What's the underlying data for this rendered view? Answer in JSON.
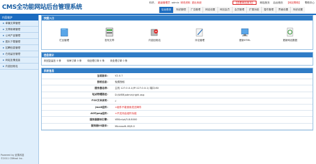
{
  "header": {
    "logo_text": "CMS全功能网站后台管理系统",
    "greeting_prefix": "你好，",
    "role": "超级管理员",
    "user": "admin",
    "settings_link": "修改资料",
    "logout_link": "退出系统",
    "view_site": "【查看网站首页】",
    "top_links": [
      "网站首页",
      "后台首页"
    ],
    "site_help": "【网站帮助】",
    "help_center": "帮助中心"
  },
  "nav": [
    "后台首页",
    "系统管理",
    "广告管理",
    "网站设置",
    "网站会员",
    "会员管理",
    "扩展功能",
    "插件管理",
    "界面设置",
    "系统设置"
  ],
  "sidebar": {
    "title": "内容维护",
    "items": [
      "单篇文章管理",
      "文章新闻管理",
      "公司产品管理",
      "图片下载管理",
      "招聘信息管理",
      "在线留言管理",
      "网站友情连接",
      "内容回收站"
    ]
  },
  "footer": {
    "line1": "Powered by 武夷科技",
    "line2": "©2011 CBHost Inc."
  },
  "quick": {
    "title": "快捷入口",
    "items": [
      {
        "label": "栏目管理",
        "icon": "folder-icon"
      },
      {
        "label": "发布文章",
        "icon": "server-icon"
      },
      {
        "label": "内容回收站",
        "icon": "recycle-icon"
      },
      {
        "label": "评论管理",
        "icon": "comment-icon"
      },
      {
        "label": "更新HTML",
        "icon": "update-icon"
      },
      {
        "label": "更新网站数据",
        "icon": "refresh-data-icon"
      }
    ]
  },
  "stats": {
    "title": "信息统计",
    "items": [
      "未回复留言 0 条",
      "待审订单 0 条",
      "待处理订单 0 条",
      "未处理订单 0 条"
    ]
  },
  "sysinfo": {
    "title": "系统信息",
    "rows": [
      {
        "key": "当前版本：",
        "value": "V2.0.7",
        "red": false
      },
      {
        "key": "授权信息：",
        "value": "免费授权",
        "red": false
      },
      {
        "key": "服务器名称：",
        "value": "主机 127.0.0.1(IP:127.0.0.1) 端口:80",
        "red": false
      },
      {
        "key": "站点物理路径：",
        "value": "D:\\WEB\\admin\\right.asp",
        "red": false
      },
      {
        "key": "FSO文本读写：",
        "value": "√",
        "red": false
      },
      {
        "key": "Jmail组件：",
        "value": "×组件不能使用发送邮件",
        "red": true
      },
      {
        "key": "ASPJpeg组件：",
        "value": "×不支持此组件功能",
        "red": true
      },
      {
        "key": "服务器脚本引擎：",
        "value": "VBScript/5.8.8000",
        "red": false
      },
      {
        "key": "服务器IIS版本：",
        "value": "Microsoft-IIS/6.0",
        "red": false
      }
    ]
  },
  "colors": {
    "accent": "#1c6cc0",
    "panel_head": "#2f7cc6",
    "warning": "#dd2222",
    "sidebar_bg": "#dfeefb"
  }
}
